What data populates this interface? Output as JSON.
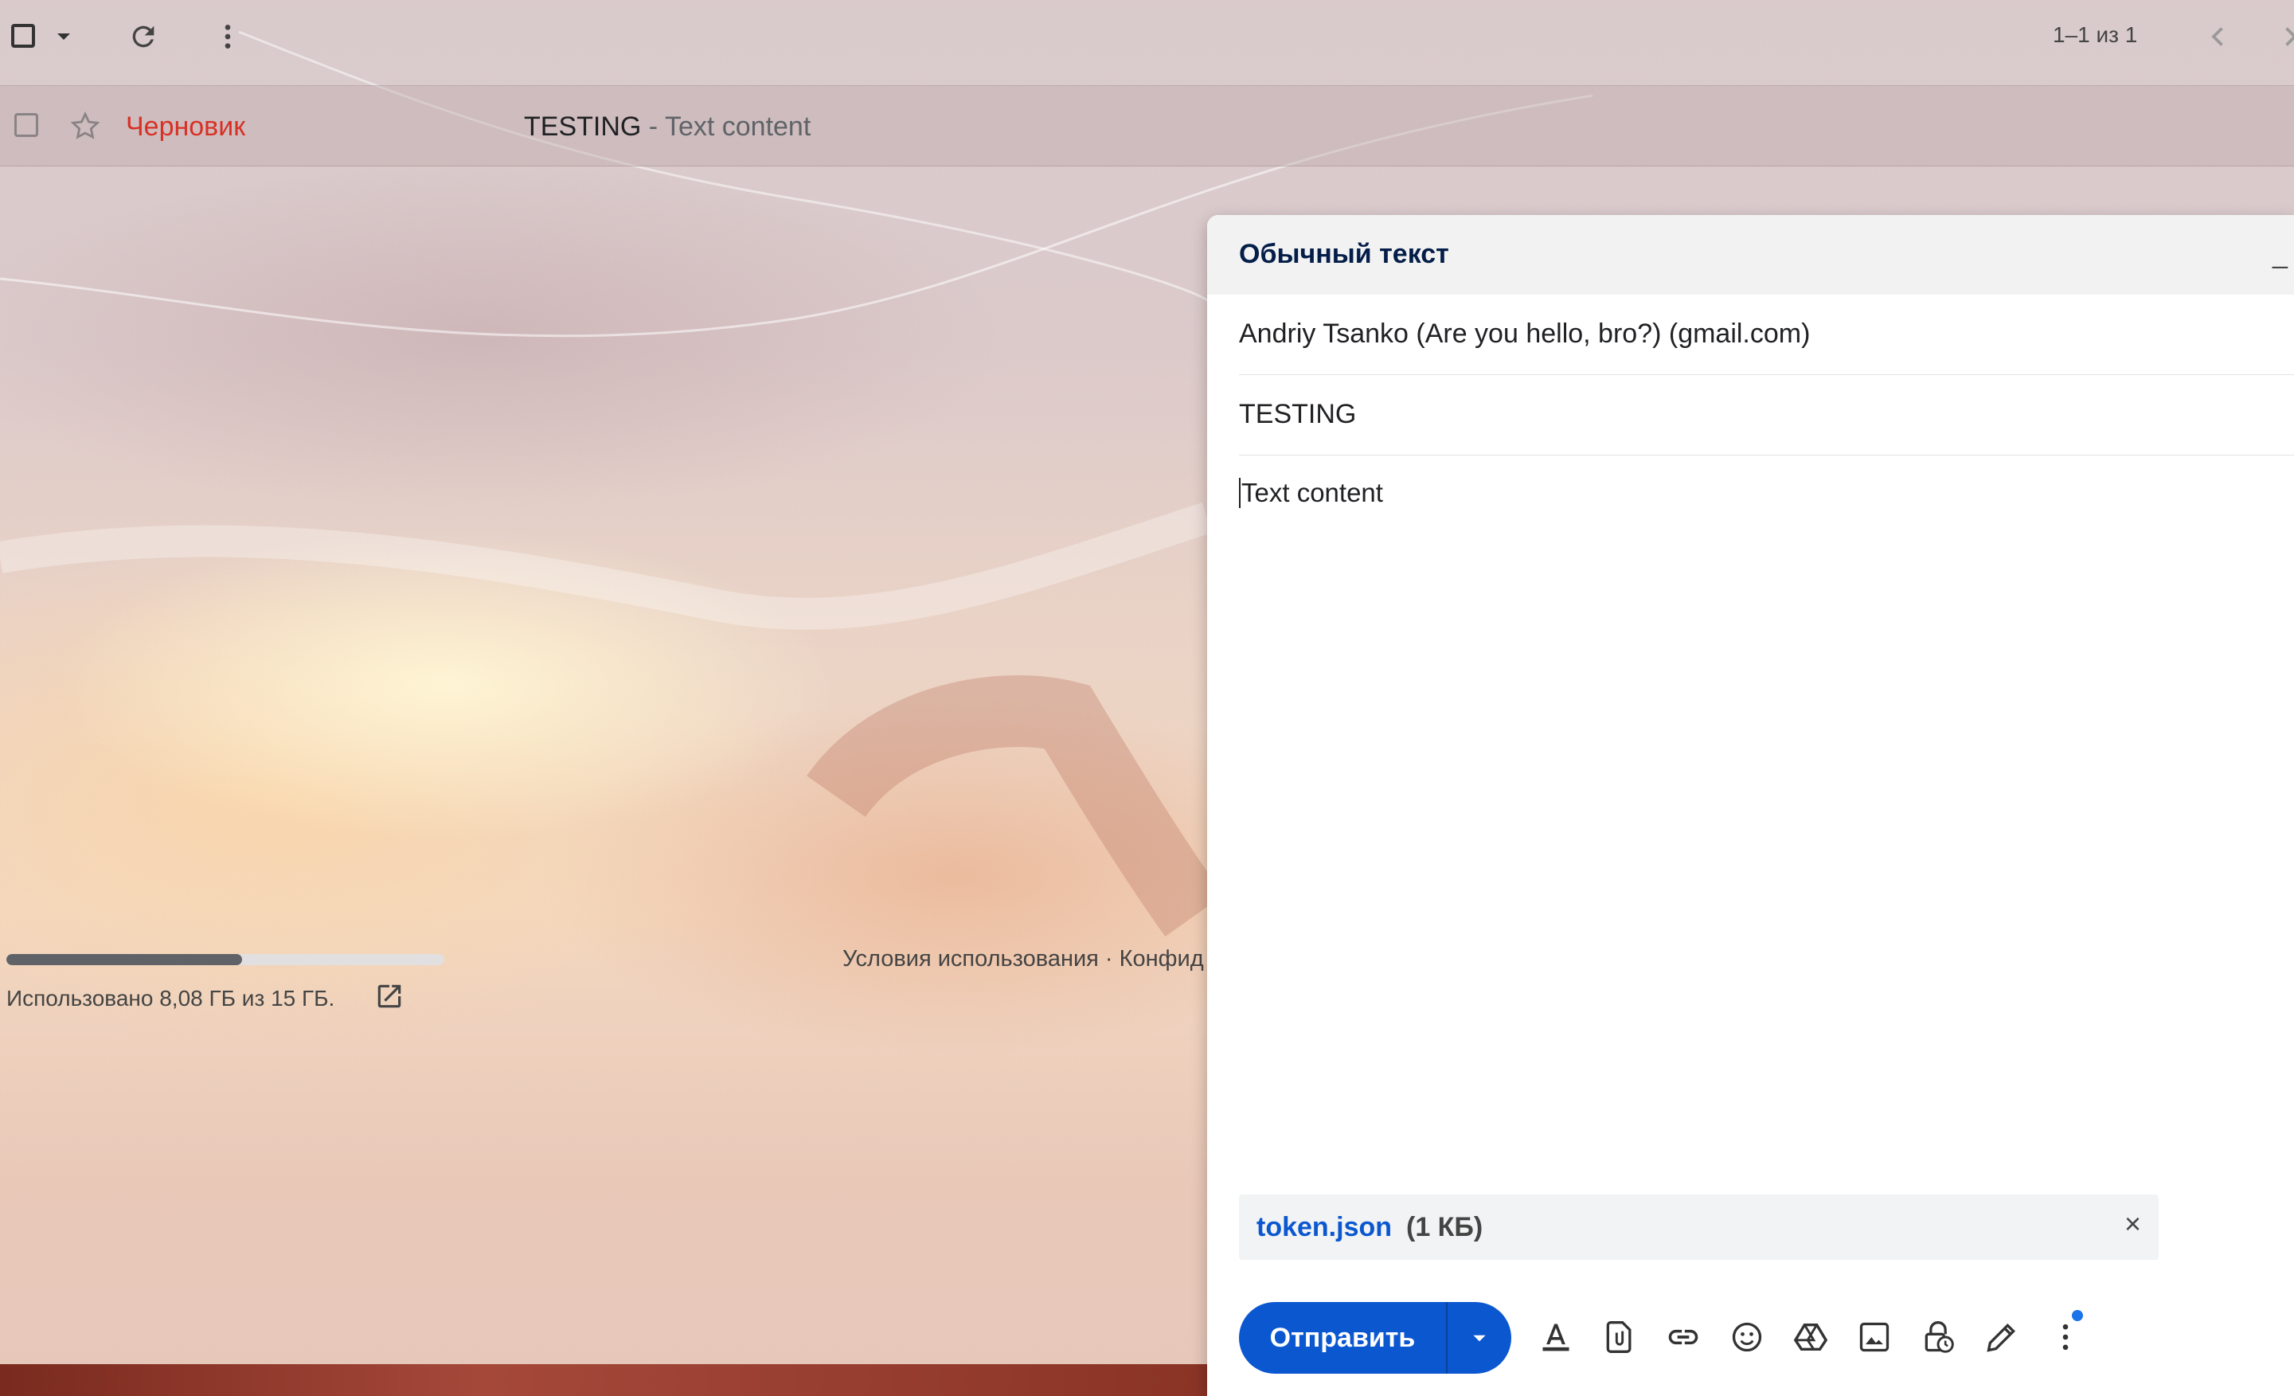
{
  "toolbar": {
    "pagination": "1–1 из 1"
  },
  "list": {
    "row": {
      "label": "Черновик",
      "subject": "TESTING",
      "separator": " - ",
      "snippet": "Text content"
    }
  },
  "storage": {
    "used_fraction": 0.539,
    "text": "Использовано 8,08 ГБ из 15 ГБ."
  },
  "footer": {
    "links": "Условия использования · Конфид"
  },
  "compose": {
    "title": "Обычный текст",
    "minimize_label": "_",
    "to": "Andriy Tsanko (Are you hello, bro?) (gmail.com)",
    "subject": "TESTING",
    "body": "Text content",
    "attachment": {
      "name": "token.json",
      "size": "(1 КБ)",
      "remove_label": "×"
    },
    "send_label": "Отправить"
  },
  "colors": {
    "send_blue": "#0b57d0",
    "draft_red": "#d93025",
    "notification_dot": "#1a73e8"
  }
}
